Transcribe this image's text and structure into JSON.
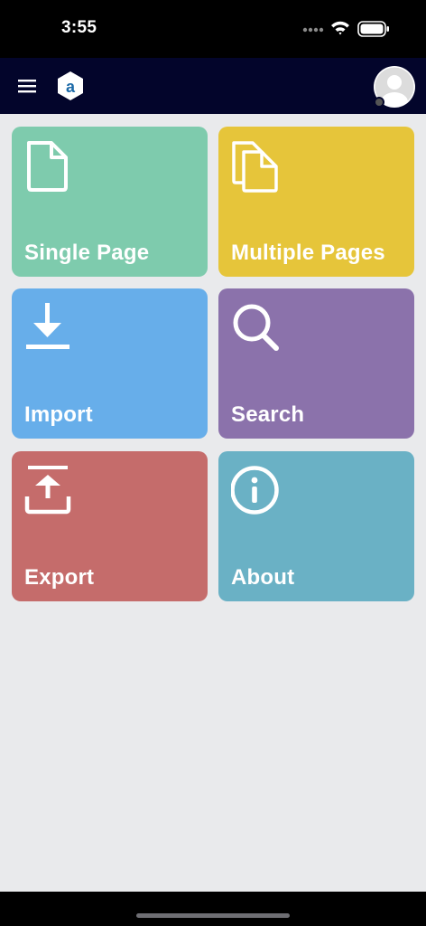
{
  "status_bar": {
    "time": "3:55"
  },
  "app_bar": {
    "menu_icon": "hamburger-menu-icon",
    "logo_icon": "app-logo-icon",
    "logo_letter": "a",
    "avatar_icon": "user-avatar-icon"
  },
  "tiles": [
    {
      "label": "Single Page",
      "icon": "single-page-icon",
      "color": "#7ecbad"
    },
    {
      "label": "Multiple Pages",
      "icon": "multiple-pages-icon",
      "color": "#e6c53a"
    },
    {
      "label": "Import",
      "icon": "import-download-icon",
      "color": "#67aeea"
    },
    {
      "label": "Search",
      "icon": "search-icon",
      "color": "#8b72ab"
    },
    {
      "label": "Export",
      "icon": "export-upload-icon",
      "color": "#c56c6b"
    },
    {
      "label": "About",
      "icon": "info-icon",
      "color": "#6ab1c5"
    }
  ]
}
